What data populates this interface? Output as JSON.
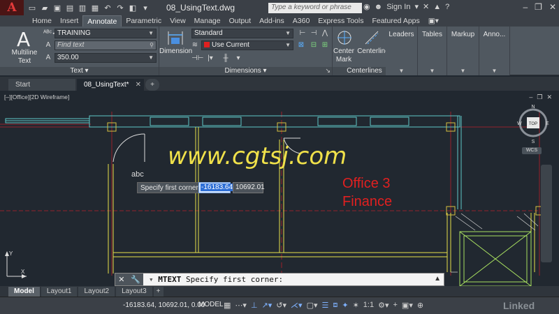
{
  "titlebar": {
    "app_letter": "A",
    "doc_title": "08_UsingText.dwg",
    "search_placeholder": "Type a keyword or phrase",
    "sign_in": "Sign In"
  },
  "ribbon_tabs": [
    "Home",
    "Insert",
    "Annotate",
    "Parametric",
    "View",
    "Manage",
    "Output",
    "Add-ins",
    "A360",
    "Express Tools",
    "Featured Apps"
  ],
  "active_ribbon_tab": "Annotate",
  "text_panel": {
    "title": "Text",
    "multiline_label_1": "Multiline",
    "multiline_label_2": "Text",
    "style_value": "TRAINING",
    "find_placeholder": "Find text",
    "height_value": "350.00"
  },
  "dimensions_panel": {
    "title": "Dimensions",
    "dimension_label": "Dimension",
    "style_value": "Standard",
    "layer_value": "Use Current"
  },
  "centerlines_panel": {
    "title": "Centerlines",
    "center_mark_1": "Center",
    "center_mark_2": "Mark",
    "centerline": "Centerline"
  },
  "collapsed_panels": [
    "Leaders",
    "Tables",
    "Markup",
    "Anno..."
  ],
  "file_tabs": {
    "start": "Start",
    "active": "08_UsingText*"
  },
  "viewport_label": "[–][Office][2D Wireframe]",
  "viewcube": {
    "n": "N",
    "s": "S",
    "w": "W",
    "e": "E",
    "top": "TOP",
    "wcs": "WCS"
  },
  "watermark": "www.cgtsj.com",
  "office_label_1": "Office 3",
  "office_label_2": "Finance",
  "dynamic_input": {
    "prompt": "Specify first corner:",
    "x_value": "-16183.64",
    "y_value": "10692.01"
  },
  "cursor_text": "abc",
  "ucs": {
    "x": "X",
    "y": "Y"
  },
  "command_line": {
    "command": "MTEXT",
    "prompt": "Specify first corner:"
  },
  "layout_tabs": [
    "Model",
    "Layout1",
    "Layout2",
    "Layout3"
  ],
  "status": {
    "coords": "-16183.64, 10692.01, 0.00",
    "model": "MODEL",
    "scale": "1:1",
    "brand": "Linked"
  },
  "colors": {
    "wall_yellow": "#e8e04a",
    "window_cyan": "#5fc8c8",
    "column_red": "#d03030",
    "grid_red": "#b8202a",
    "office_text": "#e02020",
    "watermark": "#f0e14a"
  }
}
